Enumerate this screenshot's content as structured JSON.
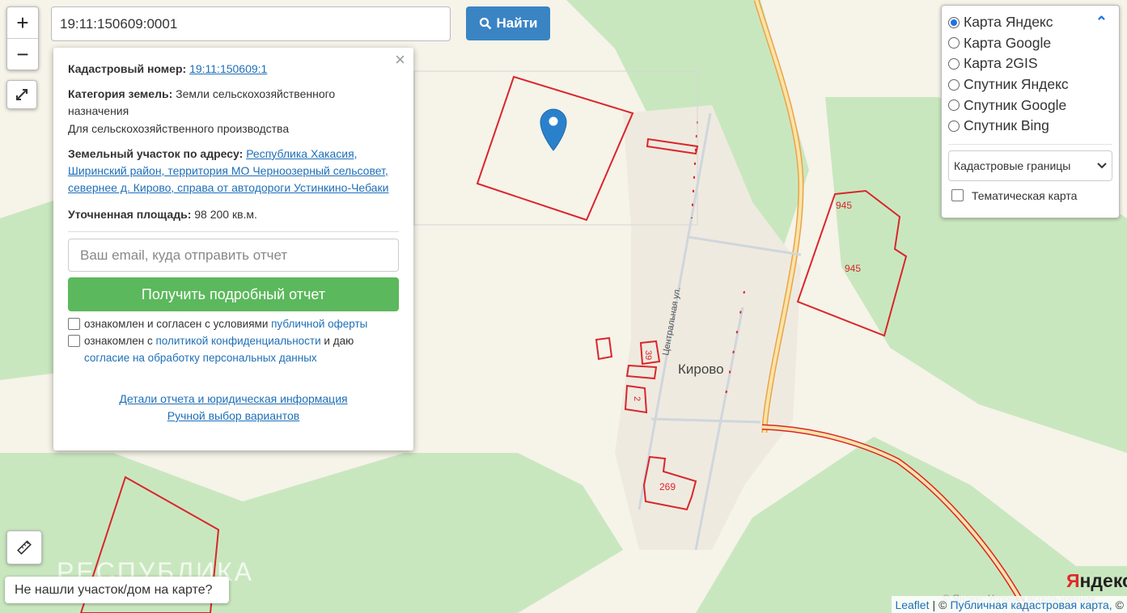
{
  "search": {
    "value": "19:11:150609:0001",
    "button_label": "Найти"
  },
  "zoom": {
    "in": "+",
    "out": "−"
  },
  "popup": {
    "cadastral_label": "Кадастровый номер:",
    "cadastral_value": "19:11:150609:1",
    "category_label": "Категория земель:",
    "category_value": "Земли сельскохозяйственного назначения",
    "usage": "Для сельскохозяйственного производства",
    "address_label": "Земельный участок по адресу:",
    "address_value": "Республика Хакасия, Ширинский район, территория МО Черноозерный сельсовет, севернее д. Кирово, справа от автодороги Устинкино-Чебаки",
    "area_label": "Уточненная площадь:",
    "area_value": "98 200 кв.м.",
    "email_placeholder": "Ваш email, куда отправить отчет",
    "report_button": "Получить подробный отчет",
    "consent1_text": "ознакомлен и согласен с условиями",
    "consent1_link": "публичной оферты",
    "consent2_text": "ознакомлен с",
    "consent2_link": "политикой конфиденциальности",
    "consent2_text2": "и даю",
    "consent2_link2": "согласие на обработку персональных данных",
    "details_link": "Детали отчета и юридическая информация",
    "manual_link": "Ручной выбор вариантов",
    "close": "×"
  },
  "layers": {
    "options": [
      {
        "label": "Карта Яндекс",
        "selected": true
      },
      {
        "label": "Карта Google",
        "selected": false
      },
      {
        "label": "Карта 2GIS",
        "selected": false
      },
      {
        "label": "Спутник Яндекс",
        "selected": false
      },
      {
        "label": "Спутник Google",
        "selected": false
      },
      {
        "label": "Спутник Bing",
        "selected": false
      }
    ],
    "overlay_select": "Кадастровые границы",
    "thematic_label": "Тематическая карта"
  },
  "map_labels": {
    "village": "Кирово",
    "street": "Центральная ул.",
    "parcel_945_a": "945",
    "parcel_945_b": "945",
    "parcel_39": "39",
    "parcel_2": "2",
    "parcel_269": "269",
    "region": "РЕСПУБЛИКА"
  },
  "not_found": "Не нашли участок/дом на карте?",
  "attribution": {
    "leaflet": "Leaflet",
    "sep": "|",
    "copy": "©",
    "pkk": "Публичная кадастровая карта,",
    "copy2": "©"
  },
  "yandex": {
    "logo_red": "Я",
    "logo_rest": "ндекс",
    "terms": "© Яндекс Условия использования"
  },
  "colors": {
    "accent": "#3a84c4",
    "report_button": "#5cb85c",
    "parcel_border": "#d9262c",
    "forest": "#c9e7bf",
    "road": "#f2c27a"
  }
}
